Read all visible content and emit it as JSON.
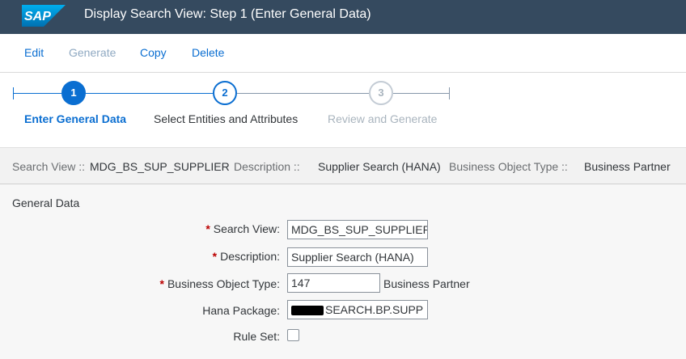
{
  "shell": {
    "logo_text": "SAP",
    "title": "Display Search View: Step 1  (Enter General Data)"
  },
  "toolbar": {
    "edit_label": "Edit",
    "generate_label": "Generate",
    "copy_label": "Copy",
    "delete_label": "Delete"
  },
  "roadmap": {
    "steps": [
      {
        "number": "1",
        "label": "Enter General Data",
        "state": "active"
      },
      {
        "number": "2",
        "label": "Select Entities and Attributes",
        "state": "open"
      },
      {
        "number": "3",
        "label": "Review and Generate",
        "state": "disabled"
      }
    ]
  },
  "infobar": {
    "search_view_label": "Search View ::",
    "search_view_value": "MDG_BS_SUP_SUPPLIER",
    "description_label": "Description ::",
    "description_value": "Supplier Search (HANA)",
    "bo_type_label": "Business Object Type ::",
    "bo_type_value": "Business Partner"
  },
  "form": {
    "section_title": "General Data",
    "required_marker": "*",
    "search_view": {
      "label": "Search View:",
      "value": "MDG_BS_SUP_SUPPLIER"
    },
    "description": {
      "label": "Description:",
      "value": "Supplier Search (HANA)"
    },
    "bo_type": {
      "label": "Business Object Type:",
      "value": "147",
      "text": "Business Partner"
    },
    "hana_package": {
      "label": "Hana Package:",
      "value": "SEARCH.BP.SUPP"
    },
    "rule_set": {
      "label": "Rule Set:",
      "checked": false
    }
  },
  "colors": {
    "shell_bg": "#354a5f",
    "accent": "#0a6ed1",
    "required": "#bb0000"
  }
}
